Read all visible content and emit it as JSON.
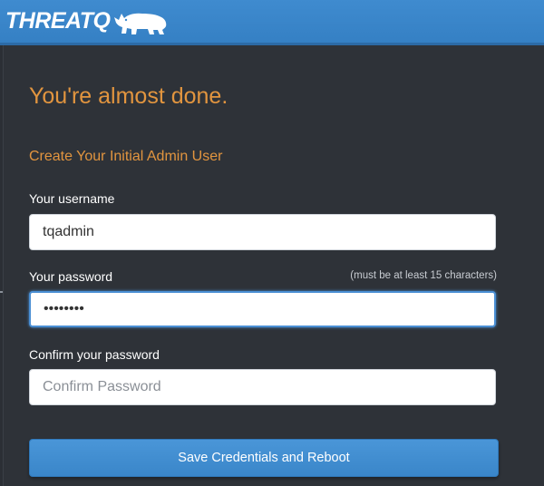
{
  "brand": {
    "name": "THREATQ",
    "logo_icon": "rhino-icon"
  },
  "form": {
    "heading": "You're almost done.",
    "subheading": "Create Your Initial Admin User",
    "username": {
      "label": "Your username",
      "value": "tqadmin"
    },
    "password": {
      "label": "Your password",
      "hint": "(must be at least 15 characters)",
      "value": "••••••••"
    },
    "confirm": {
      "label": "Confirm your password",
      "placeholder": "Confirm Password",
      "value": ""
    },
    "submit_label": "Save Credentials and Reboot"
  },
  "colors": {
    "header": "#3f8bcf",
    "accent": "#e2953f",
    "panel": "#2e3238",
    "button": "#4a96d8"
  }
}
